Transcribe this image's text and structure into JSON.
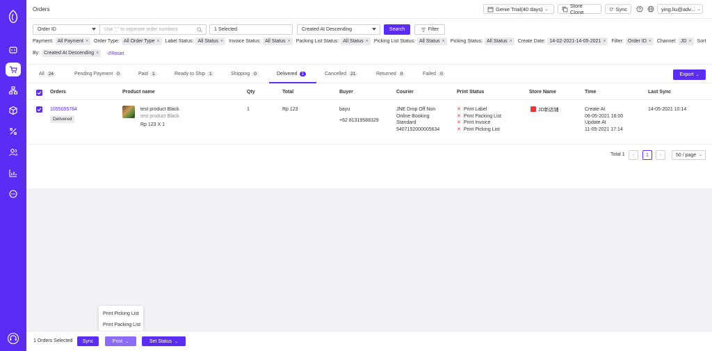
{
  "header": {
    "title": "Orders",
    "trial_label": "Genie Trial(40 days)",
    "store_clone_label": "Store Clone",
    "sync_label": "Sync",
    "user_label": "ying.liu@adv..."
  },
  "filters": {
    "search_type": "Order ID",
    "search_placeholder": "Use \",\" to seperate order numbers",
    "selected_label": "1 Selected",
    "sort_value": "Created At Descending",
    "search_button": "Search",
    "filter_button": "Filter",
    "payment_label": "Payment:",
    "payment_value": "All Payment",
    "order_type_label": "Order Type:",
    "order_type_value": "All Order Type",
    "label_status_label": "Label Status:",
    "label_status_value": "All Status",
    "invoice_status_label": "Invoice Status:",
    "invoice_status_value": "All Status",
    "packing_list_status_label": "Packing List Status:",
    "packing_list_status_value": "All Status",
    "picking_list_status_label": "Picking List Status:",
    "picking_list_status_value": "All Status",
    "picking_status_label": "Picking Status:",
    "picking_status_value": "All Status",
    "create_date_label": "Create Date:",
    "create_date_value": "14-02-2021-14-05-2021",
    "filter_label": "Filter:",
    "filter_value": "Order ID",
    "channel_label": "Channel:",
    "channel_value": "JD",
    "sort_by_label_1": "Sort",
    "sort_by_label_2": "By:",
    "sort_by_value": "Created At Descending",
    "reset_label": "Reset"
  },
  "tabs": [
    {
      "label": "All",
      "count": "24"
    },
    {
      "label": "Pending Payment",
      "count": "0"
    },
    {
      "label": "Paid",
      "count": "1"
    },
    {
      "label": "Ready to Ship",
      "count": "1"
    },
    {
      "label": "Shipping",
      "count": "0"
    },
    {
      "label": "Delivered",
      "count": "1"
    },
    {
      "label": "Cancelled",
      "count": "21"
    },
    {
      "label": "Returned",
      "count": "0"
    },
    {
      "label": "Failed",
      "count": "0"
    }
  ],
  "export_label": "Export",
  "table": {
    "headers": [
      "Orders",
      "Product name",
      "Qty",
      "Total",
      "Buyer",
      "Courier",
      "Print Status",
      "Store Name",
      "Time",
      "Last Sync"
    ],
    "row": {
      "order_id": "1055055784",
      "status": "Delivered",
      "product_name": "test product Black",
      "product_variant": "test product Black",
      "product_price": "Rp 123 X 1",
      "qty": "1",
      "total": "Rp 123",
      "buyer_name": "bayu",
      "buyer_phone": "+62 81319588329",
      "courier_1": "JNE Drop Off Non",
      "courier_2": "Online Booking",
      "courier_3": "Standard",
      "courier_4": "5407152000005634",
      "print_status": [
        "Print Label",
        "Print Packing List",
        "Print Invoice",
        "Print Picking List"
      ],
      "store_name": "JD新店铺",
      "time_created_label": "Create At",
      "time_created": "06-05-2021 16:00",
      "time_updated_label": "Update At",
      "time_updated": "11-05-2021 17:14",
      "last_sync": "14-05-2021 10:14"
    }
  },
  "pagination": {
    "total_label": "Total 1",
    "current_page": "1",
    "per_page": "50 / page"
  },
  "print_menu": [
    "Print Picking List",
    "Print Packing List"
  ],
  "footer": {
    "selected_text": "1 Orders Selected",
    "sync_label": "Sync",
    "print_label": "Print",
    "set_status_label": "Set Status"
  },
  "colors": {
    "accent": "#5b2df4",
    "danger": "#e53935"
  }
}
